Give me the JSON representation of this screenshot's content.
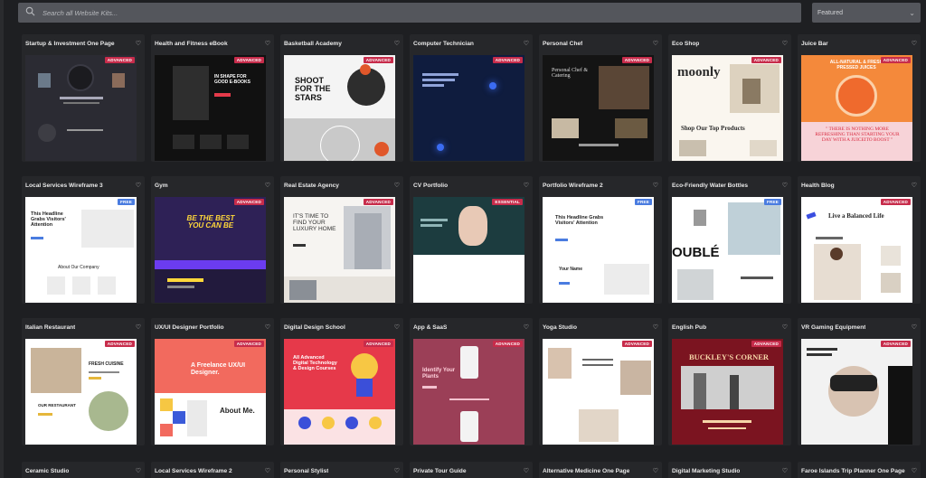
{
  "search": {
    "placeholder": "Search all Website Kits..."
  },
  "filter": {
    "selected": "Featured"
  },
  "icons": {
    "search": "search-icon",
    "heart": "heart-icon",
    "chevron": "chevron-down-icon"
  },
  "colors": {
    "background": "#1e1f22",
    "card": "#26272a",
    "search_bg": "#54565c",
    "badge_advanced": "#c72c4b",
    "badge_free": "#4a7ce0"
  },
  "kits": [
    {
      "title": "Startup & Investment One Page",
      "badge": "ADVANCED"
    },
    {
      "title": "Health and Fitness eBook",
      "badge": "ADVANCED"
    },
    {
      "title": "Basketball Academy",
      "badge": "ADVANCED"
    },
    {
      "title": "Computer Technician",
      "badge": "ADVANCED"
    },
    {
      "title": "Personal Chef",
      "badge": "ADVANCED"
    },
    {
      "title": "Eco Shop",
      "badge": "ADVANCED"
    },
    {
      "title": "Juice Bar",
      "badge": "ADVANCED"
    },
    {
      "title": "Local Services Wireframe 3",
      "badge": "FREE"
    },
    {
      "title": "Gym",
      "badge": "ADVANCED"
    },
    {
      "title": "Real Estate Agency",
      "badge": "ADVANCED"
    },
    {
      "title": "CV Portfolio",
      "badge": "ESSENTIAL"
    },
    {
      "title": "Portfolio Wireframe 2",
      "badge": "FREE"
    },
    {
      "title": "Eco-Friendly Water Bottles",
      "badge": "FREE"
    },
    {
      "title": "Health Blog",
      "badge": "ADVANCED"
    },
    {
      "title": "Italian Restaurant",
      "badge": "ADVANCED"
    },
    {
      "title": "UX/UI Designer Portfolio",
      "badge": "ADVANCED"
    },
    {
      "title": "Digital Design School",
      "badge": "ADVANCED"
    },
    {
      "title": "App & SaaS",
      "badge": "ADVANCED"
    },
    {
      "title": "Yoga Studio",
      "badge": "ADVANCED"
    },
    {
      "title": "English Pub",
      "badge": "ADVANCED"
    },
    {
      "title": "VR Gaming Equipment",
      "badge": "ADVANCED"
    }
  ],
  "bottom_kits": [
    {
      "title": "Ceramic Studio"
    },
    {
      "title": "Local Services Wireframe 2"
    },
    {
      "title": "Personal Stylist"
    },
    {
      "title": "Private Tour Guide"
    },
    {
      "title": "Alternative Medicine One Page"
    },
    {
      "title": "Digital Marketing Studio"
    },
    {
      "title": "Faroe Islands Trip Planner One Page"
    }
  ],
  "thumb_text": {
    "basketball": "SHOOT FOR THE STARS",
    "moonly": "moonly",
    "eco_shop_tagline": "Shop Our Top Products",
    "juice_headline": "ALL-NATURAL & FRESH PRESSED JUICES",
    "juice_quote": "\" THERE IS NOTHING MORE REFRESHING THAN STARTING YOUR DAY WITH A JUICEITO BOOST \"",
    "wireframe_headline": "This Headline Grabs Visitors' Attention",
    "wireframe_about": "About Our Company",
    "gym_headline": "BE THE BEST YOU CAN BE",
    "realestate_headline": "IT'S TIME TO FIND YOUR LUXURY HOME",
    "portfolio_name": "Your Name",
    "bottles_word": "OUBLÉ",
    "healthblog": "Live a Balanced Life",
    "italian_headline": "FRESH CUISINE",
    "italian_sub": "OUR RESTAURANT",
    "uxui_headline": "A Freelance UX/UI Designer.",
    "uxui_about": "About Me.",
    "design_school": "All Advanced Digital Technology & Design Courses",
    "plants": "Identify Your Plants",
    "pub_name": "BUCKLEY'S CORNER",
    "chef": "Personal Chef & Catering",
    "ebook": "IN SHAPE FOR GOOD E-BOOKS"
  }
}
